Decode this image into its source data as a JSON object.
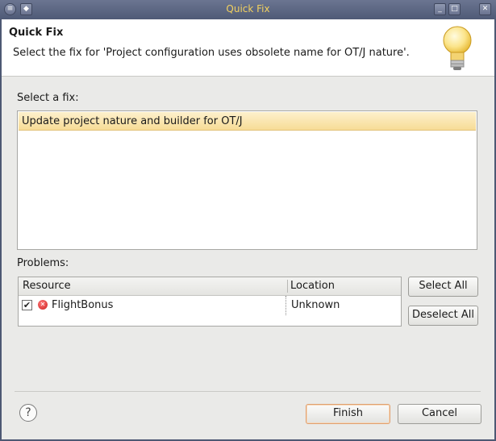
{
  "window": {
    "title": "Quick Fix"
  },
  "header": {
    "title": "Quick Fix",
    "message": "Select the fix for 'Project configuration uses obsolete name for OT/J nature'.",
    "icon": "lightbulb-icon"
  },
  "fixes": {
    "label": "Select a fix:",
    "items": [
      {
        "label": "Update project nature and builder for OT/J",
        "selected": true
      }
    ]
  },
  "problems": {
    "label": "Problems:",
    "columns": [
      "Resource",
      "Location"
    ],
    "rows": [
      {
        "checked": true,
        "icon": "error-icon",
        "resource": "FlightBonus",
        "location": "Unknown"
      }
    ],
    "select_all": "Select All",
    "deselect_all": "Deselect All"
  },
  "footer": {
    "help_icon": "help-icon",
    "finish": "Finish",
    "cancel": "Cancel"
  },
  "colors": {
    "titlebar": "#5a6480",
    "title_text": "#f2d15f",
    "selection": "#f7dc96"
  }
}
